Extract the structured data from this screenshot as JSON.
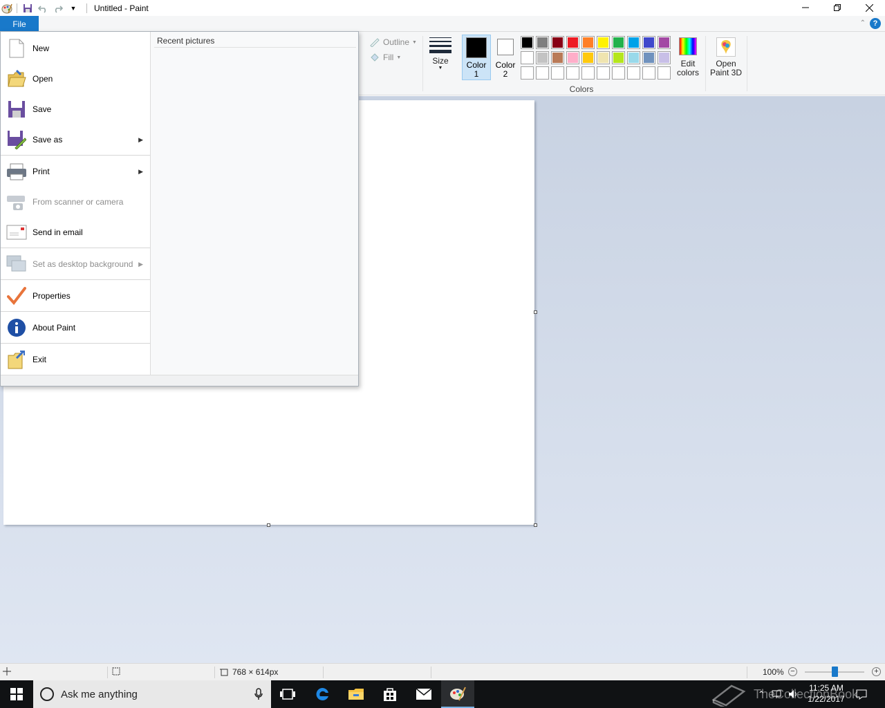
{
  "window": {
    "title": "Untitled - Paint",
    "controls": [
      "minimize",
      "restore",
      "close"
    ]
  },
  "quick_access": {
    "icons": [
      "paint-app-icon",
      "save-icon",
      "undo-icon",
      "redo-icon",
      "customize-dropdown-icon"
    ]
  },
  "ribbon": {
    "file_tab": "File",
    "outline_label": "Outline",
    "fill_label": "Fill",
    "size_label": "Size",
    "color1_label": "Color\n1",
    "color1_line1": "Color",
    "color1_line2": "1",
    "color2_line1": "Color",
    "color2_line2": "2",
    "colors_group_label": "Colors",
    "edit_colors_line1": "Edit",
    "edit_colors_line2": "colors",
    "open_paint3d_line1": "Open",
    "open_paint3d_line2": "Paint 3D",
    "color1_value": "#000000",
    "color2_value": "#ffffff",
    "palette_row1": [
      "#000000",
      "#7f7f7f",
      "#880015",
      "#ed1c24",
      "#ff7f27",
      "#fff200",
      "#22b14c",
      "#00a2e8",
      "#3f48cc",
      "#a349a4"
    ],
    "palette_row2": [
      "#ffffff",
      "#c3c3c3",
      "#b97a57",
      "#ffaec9",
      "#ffc90e",
      "#efe4b0",
      "#b5e61d",
      "#99d9ea",
      "#7092be",
      "#c8bfe7"
    ]
  },
  "file_menu": {
    "items": [
      {
        "label": "New",
        "icon": "new-document-icon",
        "disabled": false,
        "submenu": false
      },
      {
        "label": "Open",
        "icon": "open-folder-icon",
        "disabled": false,
        "submenu": false
      },
      {
        "label": "Save",
        "icon": "save-floppy-icon",
        "disabled": false,
        "submenu": false
      },
      {
        "label": "Save as",
        "icon": "save-as-icon",
        "disabled": false,
        "submenu": true
      },
      {
        "label": "Print",
        "icon": "printer-icon",
        "disabled": false,
        "submenu": true
      },
      {
        "label": "From scanner or camera",
        "icon": "scanner-icon",
        "disabled": true,
        "submenu": false
      },
      {
        "label": "Send in email",
        "icon": "email-icon",
        "disabled": false,
        "submenu": false
      },
      {
        "label": "Set as desktop background",
        "icon": "desktop-background-icon",
        "disabled": true,
        "submenu": true
      },
      {
        "label": "Properties",
        "icon": "checkmark-icon",
        "disabled": false,
        "submenu": false
      },
      {
        "label": "About Paint",
        "icon": "info-icon",
        "disabled": false,
        "submenu": false
      },
      {
        "label": "Exit",
        "icon": "exit-icon",
        "disabled": false,
        "submenu": false
      }
    ],
    "recent_title": "Recent pictures"
  },
  "statusbar": {
    "canvas_size": "768 × 614px",
    "zoom": "100%",
    "zoom_minus": "−",
    "zoom_plus": "+",
    "zoom_level_fraction": 0.5
  },
  "taskbar": {
    "search_placeholder": "Ask me anything",
    "time": "11:25 AM",
    "date": "1/22/2017",
    "watermark": "TheCollectionBook",
    "apps": [
      "task-view-icon",
      "edge-icon",
      "file-explorer-icon",
      "store-icon",
      "mail-icon",
      "paint-icon"
    ]
  }
}
